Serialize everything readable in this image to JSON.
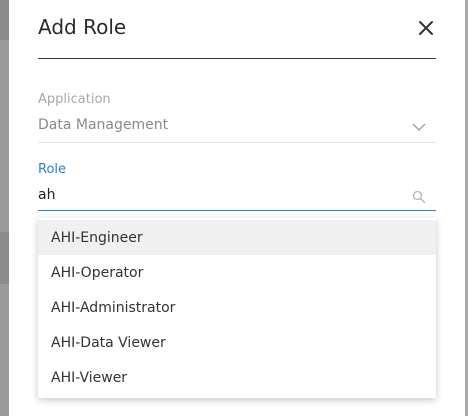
{
  "dialog": {
    "title": "Add Role",
    "close_icon": "close-icon"
  },
  "application": {
    "label": "Application",
    "value": "Data Management",
    "icon": "chevron-down-icon"
  },
  "role": {
    "label": "Role",
    "value": "ah",
    "icon": "search-icon"
  },
  "options": [
    {
      "label": "AHI-Engineer",
      "highlighted": true
    },
    {
      "label": "AHI-Operator"
    },
    {
      "label": "AHI-Administrator"
    },
    {
      "label": "AHI-Data Viewer"
    },
    {
      "label": "AHI-Viewer"
    }
  ],
  "colors": {
    "accent": "#2f80c8",
    "highlight": "#f0f0f0"
  }
}
